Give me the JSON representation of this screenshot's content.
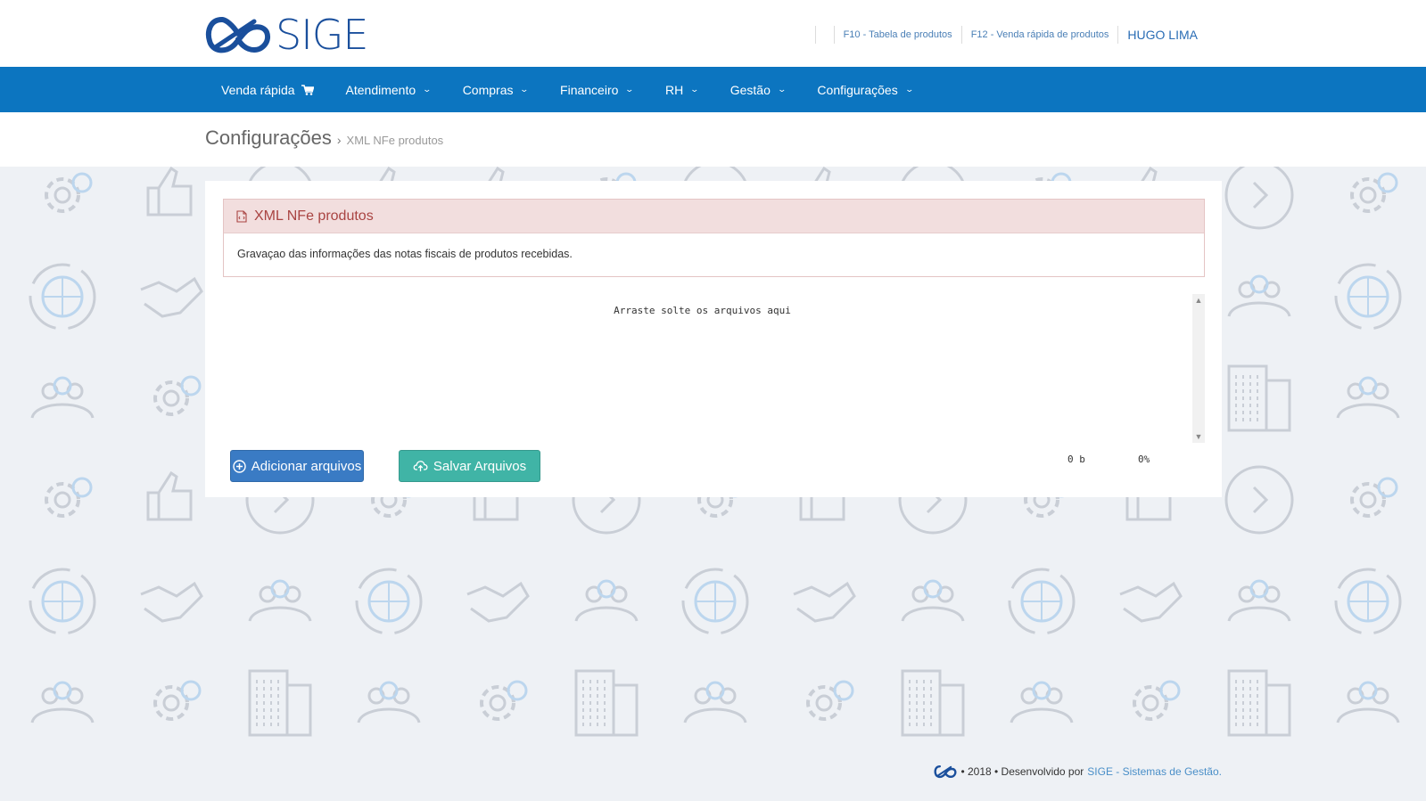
{
  "header": {
    "logo_text": "SIGE",
    "links": [
      {
        "label": "F10 - Tabela de produtos"
      },
      {
        "label": "F12 - Venda rápida de produtos"
      }
    ],
    "user_name": "HUGO LIMA"
  },
  "nav": {
    "items": [
      {
        "label": "Venda rápida",
        "icon": "cart-icon"
      },
      {
        "label": "Atendimento",
        "icon": "chevron-down-icon"
      },
      {
        "label": "Compras",
        "icon": "chevron-down-icon"
      },
      {
        "label": "Financeiro",
        "icon": "chevron-down-icon"
      },
      {
        "label": "RH",
        "icon": "chevron-down-icon"
      },
      {
        "label": "Gestão",
        "icon": "chevron-down-icon"
      },
      {
        "label": "Configurações",
        "icon": "chevron-down-icon"
      }
    ]
  },
  "breadcrumb": {
    "section": "Configurações",
    "separator": "›",
    "page": "XML NFe produtos"
  },
  "panel": {
    "title": "XML NFe produtos",
    "description": "Gravaçao das informações das notas fiscais de produtos recebidas.",
    "dropzone_text": "Arraste solte os arquivos aqui",
    "add_button": "Adicionar arquivos",
    "save_button": "Salvar Arquivos",
    "total_size": "0 b",
    "progress": "0%"
  },
  "footer": {
    "text": "• 2018 • Desenvolvido por",
    "link": "SIGE - Sistemas de Gestão."
  },
  "colors": {
    "navbar": "#0c75c0",
    "brand": "#1a4f9c",
    "alert_bg": "#f2dede",
    "alert_text": "#a94442",
    "add_button": "#3a7bc4",
    "save_button": "#40b4a6"
  }
}
